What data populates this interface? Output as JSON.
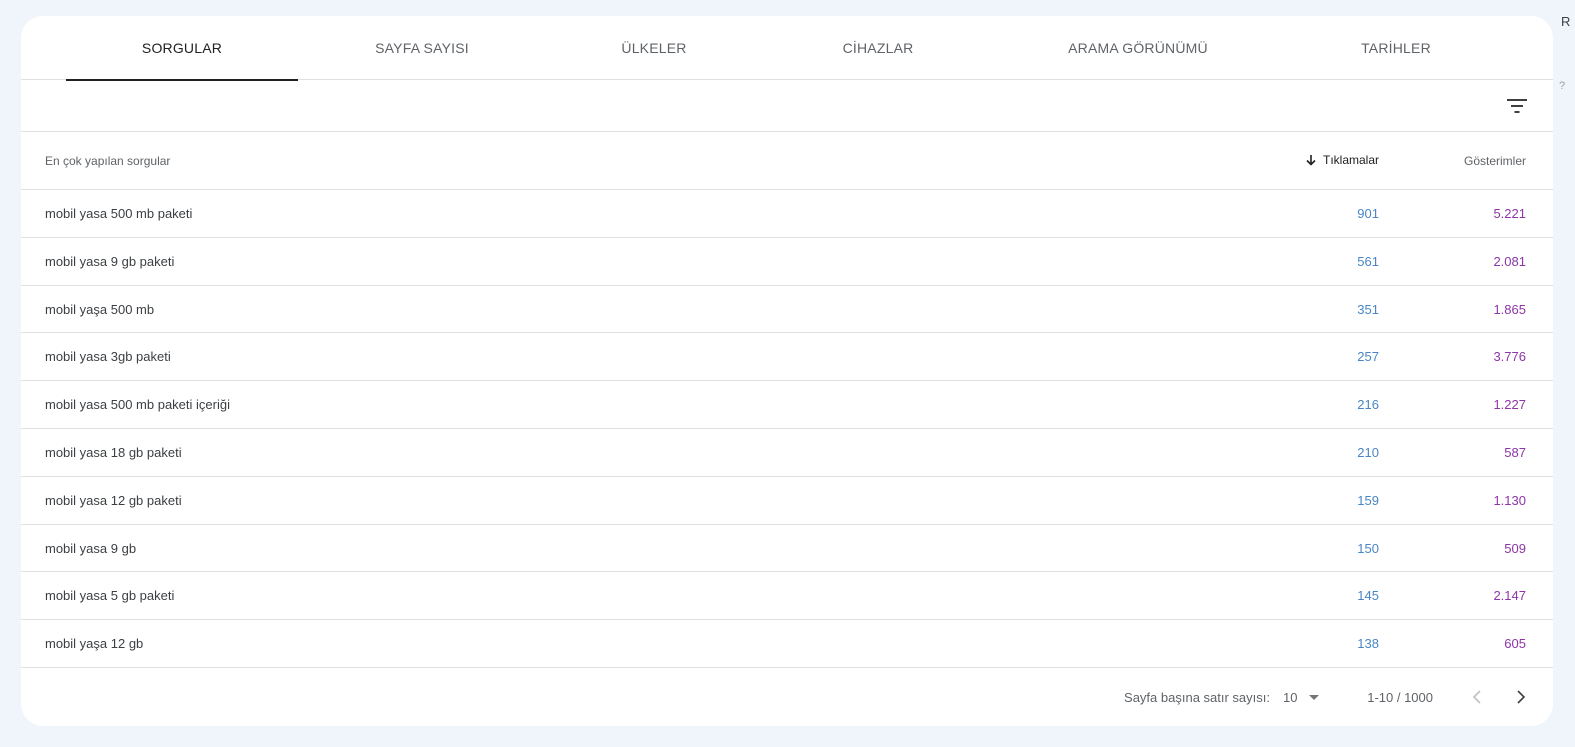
{
  "edge": {
    "glyph": "R",
    "glyph2": "?"
  },
  "tabs": [
    {
      "label": "SORGULAR",
      "active": true
    },
    {
      "label": "SAYFA SAYISI"
    },
    {
      "label": "ÜLKELER"
    },
    {
      "label": "CİHAZLAR"
    },
    {
      "label": "ARAMA GÖRÜNÜMÜ"
    },
    {
      "label": "TARİHLER"
    }
  ],
  "toolbar": {
    "filter_icon": "filter-icon"
  },
  "table": {
    "headers": {
      "query": "En çok yapılan sorgular",
      "clicks": "Tıklamalar",
      "impressions": "Gösterimler"
    },
    "sort_icon": "arrow-down-icon",
    "rows": [
      {
        "query": "mobil yasa 500 mb paketi",
        "clicks": "901",
        "impressions": "5.221"
      },
      {
        "query": "mobil yasa 9 gb paketi",
        "clicks": "561",
        "impressions": "2.081"
      },
      {
        "query": "mobil yaşa 500 mb",
        "clicks": "351",
        "impressions": "1.865"
      },
      {
        "query": "mobil yasa 3gb paketi",
        "clicks": "257",
        "impressions": "3.776"
      },
      {
        "query": "mobil yasa 500 mb paketi içeriği",
        "clicks": "216",
        "impressions": "1.227"
      },
      {
        "query": "mobil yasa 18 gb paketi",
        "clicks": "210",
        "impressions": "587"
      },
      {
        "query": "mobil yasa 12 gb paketi",
        "clicks": "159",
        "impressions": "1.130"
      },
      {
        "query": "mobil yasa 9 gb",
        "clicks": "150",
        "impressions": "509"
      },
      {
        "query": "mobil yasa 5 gb paketi",
        "clicks": "145",
        "impressions": "2.147"
      },
      {
        "query": "mobil yaşa 12 gb",
        "clicks": "138",
        "impressions": "605"
      }
    ]
  },
  "footer": {
    "rows_per_page_label": "Sayfa başına satır sayısı:",
    "rows_per_page_value": "10",
    "range": "1-10 / 1000"
  },
  "colors": {
    "clicks": "#4a86c5",
    "impressions": "#8e35a8",
    "active_tab": "#202124"
  }
}
